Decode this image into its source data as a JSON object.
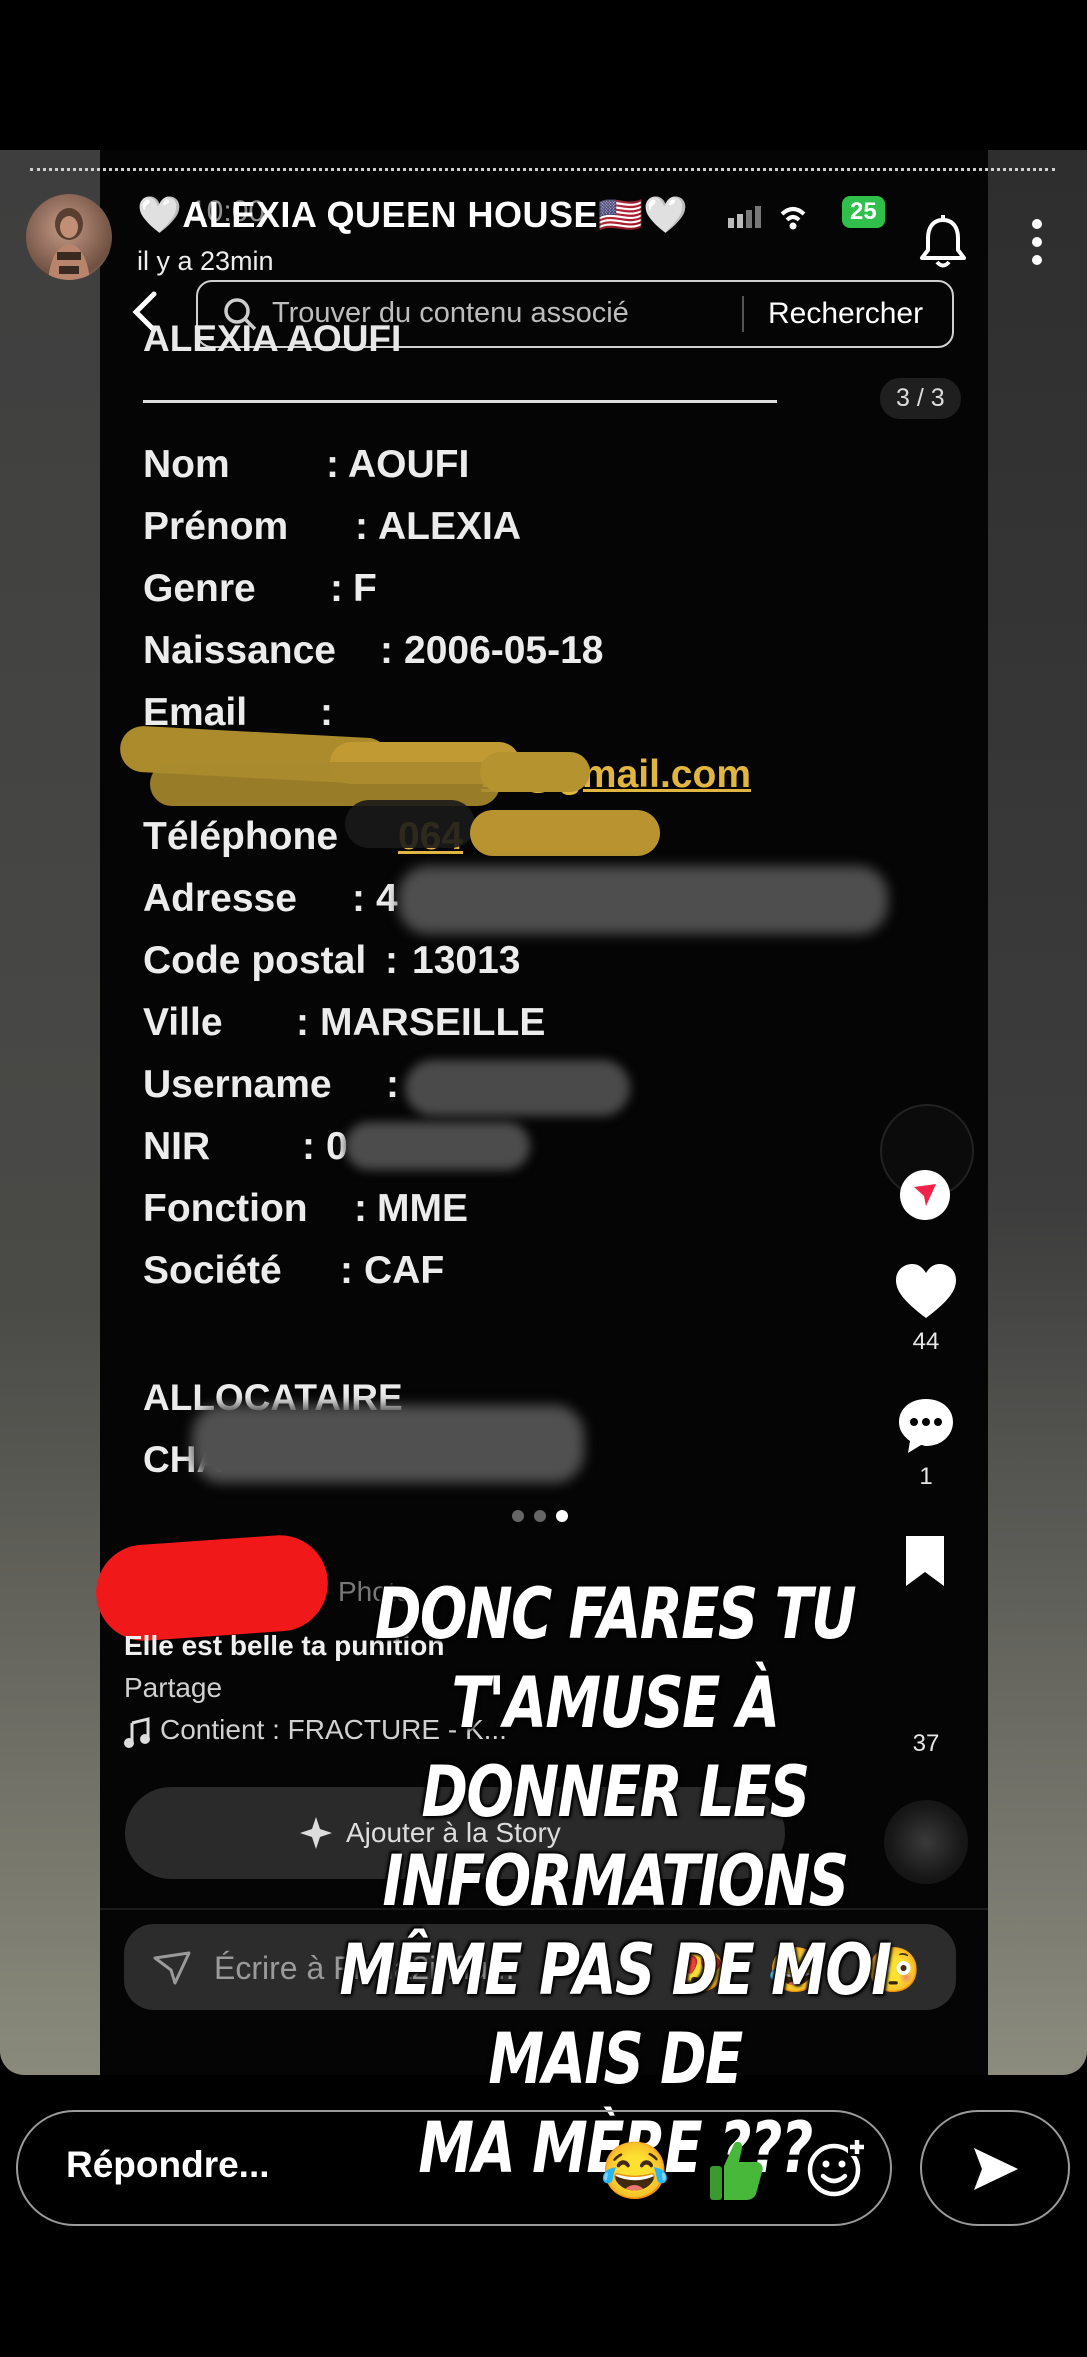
{
  "story": {
    "account_name": "🤍ALEXIA QUEEN HOUSE🇺🇸🤍",
    "posted_ago": "il y a 23min",
    "progress_segments": 1
  },
  "inner_status": {
    "time": "10:00",
    "battery": "25"
  },
  "search": {
    "placeholder": "Trouver du contenu associé",
    "button": "Rechercher"
  },
  "document": {
    "heading": "ALEXIA AOUFI",
    "page_indicator": "3 / 3",
    "fields": [
      {
        "label": "Nom",
        "sep": ":",
        "value": "AOUFI"
      },
      {
        "label": "Prénom",
        "sep": ":",
        "value": "ALEXIA"
      },
      {
        "label": "Genre",
        "sep": ":",
        "value": "F"
      },
      {
        "label": "Naissance",
        "sep": ":",
        "value": "2006-05-18"
      },
      {
        "label": "Email",
        "sep": ":",
        "value": ""
      },
      {
        "label": "",
        "sep": "",
        "value": "zz@gmail.com"
      },
      {
        "label": "Téléphone",
        "sep": "",
        "value": "064"
      },
      {
        "label": "Adresse",
        "sep": ":",
        "value": "4"
      },
      {
        "label": "Code postal",
        "sep": ":",
        "value": "13013"
      },
      {
        "label": "Ville",
        "sep": ":",
        "value": "MARSEILLE"
      },
      {
        "label": "Username",
        "sep": ":",
        "value": ""
      },
      {
        "label": "NIR",
        "sep": ":",
        "value": "0"
      },
      {
        "label": "Fonction",
        "sep": ":",
        "value": "MME"
      },
      {
        "label": "Société",
        "sep": ":",
        "value": "CAF"
      }
    ],
    "footer_line1": "ALLOCATAIRE",
    "footer_line2": "CHA"
  },
  "actions": {
    "likes": "44",
    "comments": "1",
    "saves": "37"
  },
  "music": {
    "photo_label": "Photo",
    "caption": "Elle est belle ta punition",
    "share_line": "Partage",
    "contains": "Contient : FRACTURE - K...",
    "add_story": "Ajouter à la Story"
  },
  "inner_comment": {
    "placeholder": "Écrire à Ficha2influ...",
    "emojis": [
      "😍",
      "😂",
      "😳"
    ]
  },
  "overlay_text": {
    "lines": [
      "DONC FARES TU T'AMUSE À",
      "DONNER LES INFORMATIONS",
      "MÊME PAS DE MOI MAIS DE",
      "MA MÈRE ???"
    ]
  },
  "reply": {
    "placeholder": "Répondre...",
    "emojis": [
      "😂",
      "👍"
    ]
  },
  "colors": {
    "link": "#e0b640",
    "battery": "#2fbf4a",
    "redact_red": "#f01818",
    "share_badge": "#f2224a"
  }
}
